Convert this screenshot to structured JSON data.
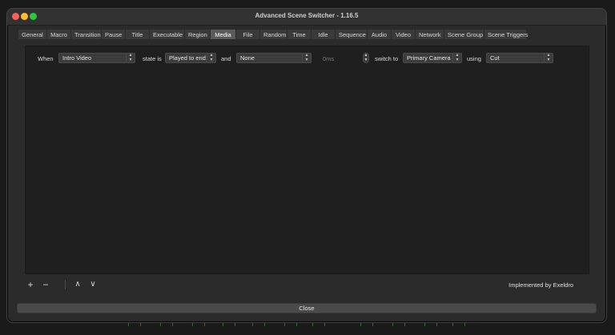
{
  "window": {
    "title": "Advanced Scene Switcher - 1.16.5"
  },
  "tabs": [
    {
      "label": "General",
      "w": 36
    },
    {
      "label": "Macro",
      "w": 30
    },
    {
      "label": "Transition",
      "w": 38
    },
    {
      "label": "Pause",
      "w": 30
    },
    {
      "label": "Title",
      "w": 30
    },
    {
      "label": "Executable",
      "w": 44
    },
    {
      "label": "Region",
      "w": 32
    },
    {
      "label": "Media",
      "w": 32
    },
    {
      "label": "File",
      "w": 30
    },
    {
      "label": "Random",
      "w": 34
    },
    {
      "label": "Time",
      "w": 30
    },
    {
      "label": "Idle",
      "w": 30
    },
    {
      "label": "Sequence",
      "w": 40
    },
    {
      "label": "Audio",
      "w": 30
    },
    {
      "label": "Video",
      "w": 30
    },
    {
      "label": "Network",
      "w": 36
    },
    {
      "label": "Scene Group",
      "w": 50
    },
    {
      "label": "Scene Triggers",
      "w": 54
    }
  ],
  "active_tab": "Media",
  "rule": {
    "when_label": "When",
    "source_value": "Intro Video",
    "state_label": "state is",
    "state_value": "Played to end",
    "and_label": "and",
    "condition_value": "None",
    "time_value": "0ms",
    "switch_label": "switch to",
    "scene_value": "Primary Camera",
    "using_label": "using",
    "transition_value": "Cut"
  },
  "toolbar": {
    "add_glyph": "+",
    "remove_glyph": "−",
    "up_glyph": "∧",
    "down_glyph": "∨",
    "implemented_by": "Implemented by Exeldro"
  },
  "close_label": "Close"
}
